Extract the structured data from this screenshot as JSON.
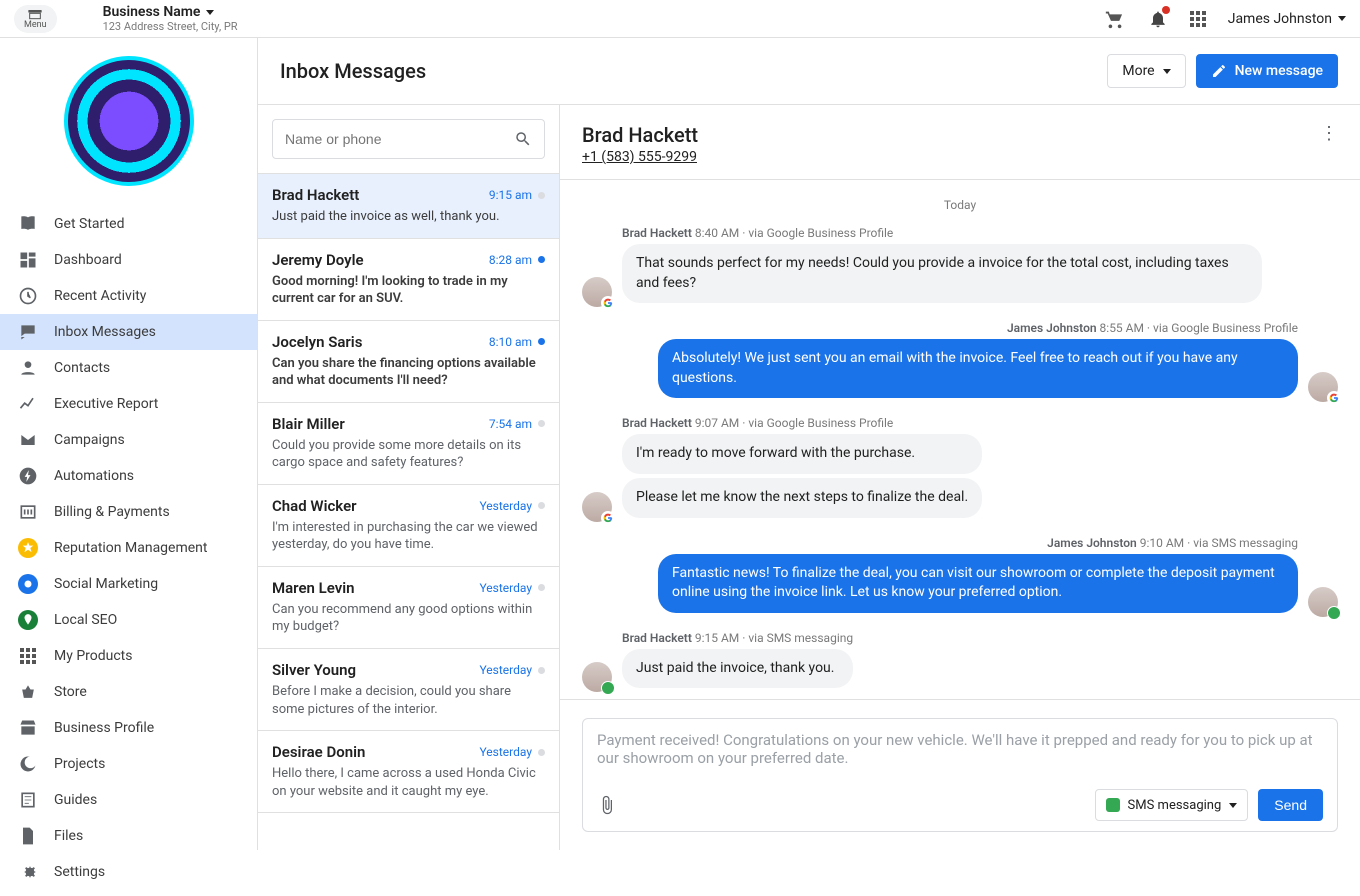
{
  "topbar": {
    "menu_label": "Menu",
    "business_name": "Business Name",
    "business_address": "123 Address Street, City, PR",
    "user_name": "James Johnston"
  },
  "sidebar": {
    "items": [
      {
        "icon": "book-open",
        "label": "Get Started"
      },
      {
        "icon": "dashboard",
        "label": "Dashboard"
      },
      {
        "icon": "clock",
        "label": "Recent Activity"
      },
      {
        "icon": "inbox",
        "label": "Inbox Messages",
        "active": true
      },
      {
        "icon": "person",
        "label": "Contacts"
      },
      {
        "icon": "chart",
        "label": "Executive Report"
      },
      {
        "icon": "mail",
        "label": "Campaigns"
      },
      {
        "icon": "bolt",
        "label": "Automations"
      },
      {
        "icon": "billing",
        "label": "Billing & Payments"
      },
      {
        "icon": "star",
        "label": "Reputation Management",
        "color": "yellow"
      },
      {
        "icon": "social",
        "label": "Social Marketing",
        "color": "blue"
      },
      {
        "icon": "pin",
        "label": "Local SEO",
        "color": "green"
      },
      {
        "icon": "apps",
        "label": "My Products"
      },
      {
        "icon": "basket",
        "label": "Store"
      },
      {
        "icon": "storefront",
        "label": "Business Profile"
      },
      {
        "icon": "moon",
        "label": "Projects"
      },
      {
        "icon": "guides",
        "label": "Guides"
      },
      {
        "icon": "files",
        "label": "Files"
      },
      {
        "icon": "gear",
        "label": "Settings"
      }
    ]
  },
  "page": {
    "title": "Inbox Messages",
    "more_label": "More",
    "new_message_label": "New message"
  },
  "search": {
    "placeholder": "Name or phone"
  },
  "threads": [
    {
      "name": "Brad Hackett",
      "time": "9:15 am",
      "preview": "Just paid the invoice as well, thank you.",
      "active": true,
      "unread": false
    },
    {
      "name": "Jeremy Doyle",
      "time": "8:28 am",
      "preview": "Good morning! I'm looking to trade in my current car for an SUV.",
      "unread": true
    },
    {
      "name": "Jocelyn Saris",
      "time": "8:10 am",
      "preview": "Can you share the financing options available and what documents I'll need?",
      "unread": true
    },
    {
      "name": "Blair Miller",
      "time": "7:54 am",
      "preview": "Could you provide some more details on its cargo space and safety features?",
      "unread": false,
      "read": true
    },
    {
      "name": "Chad Wicker",
      "time": "Yesterday",
      "preview": "I'm interested in purchasing the car we viewed yesterday, do you have time.",
      "unread": false,
      "read": true
    },
    {
      "name": "Maren Levin",
      "time": "Yesterday",
      "preview": "Can you recommend any good options within my budget?",
      "unread": false,
      "read": true
    },
    {
      "name": "Silver Young",
      "time": "Yesterday",
      "preview": "Before I make a decision, could you share some pictures of the interior.",
      "unread": false,
      "read": true
    },
    {
      "name": "Desirae Donin",
      "time": "Yesterday",
      "preview": "Hello there, I came across a used Honda Civic on your website and it caught my eye.",
      "unread": false,
      "read": true
    }
  ],
  "conversation": {
    "contact_name": "Brad Hackett",
    "contact_phone": "+1 (583) 555-9299",
    "date_label": "Today",
    "messages": [
      {
        "dir": "in",
        "sender": "Brad Hackett",
        "time": "8:40 AM",
        "via": "via Google Business Profile",
        "badge": "g",
        "bubbles": [
          "That sounds perfect for my needs! Could you provide a invoice for the total cost, including taxes and fees?"
        ]
      },
      {
        "dir": "out",
        "sender": "James Johnston",
        "time": "8:55 AM",
        "via": "via Google Business Profile",
        "badge": "g",
        "bubbles": [
          "Absolutely! We just sent you an email with the invoice. Feel free to reach out if you have any questions."
        ]
      },
      {
        "dir": "in",
        "sender": "Brad Hackett",
        "time": "9:07 AM",
        "via": "via Google Business Profile",
        "badge": "g",
        "bubbles": [
          "I'm ready to move forward with the purchase.",
          "Please let me know the next steps to finalize the deal."
        ]
      },
      {
        "dir": "out",
        "sender": "James Johnston",
        "time": "9:10 AM",
        "via": "via SMS messaging",
        "badge": "sms",
        "bubbles": [
          "Fantastic news! To finalize the deal, you can visit our showroom or complete the deposit payment online using the invoice link. Let us know your preferred option."
        ]
      },
      {
        "dir": "in",
        "sender": "Brad Hackett",
        "time": "9:15 AM",
        "via": "via SMS messaging",
        "badge": "sms",
        "bubbles": [
          "Just paid the invoice, thank you."
        ]
      }
    ]
  },
  "composer": {
    "draft": "Payment received! Congratulations on your new vehicle. We'll have it prepped and ready for you to pick up at our showroom on your preferred date.",
    "channel_label": "SMS messaging",
    "send_label": "Send"
  }
}
